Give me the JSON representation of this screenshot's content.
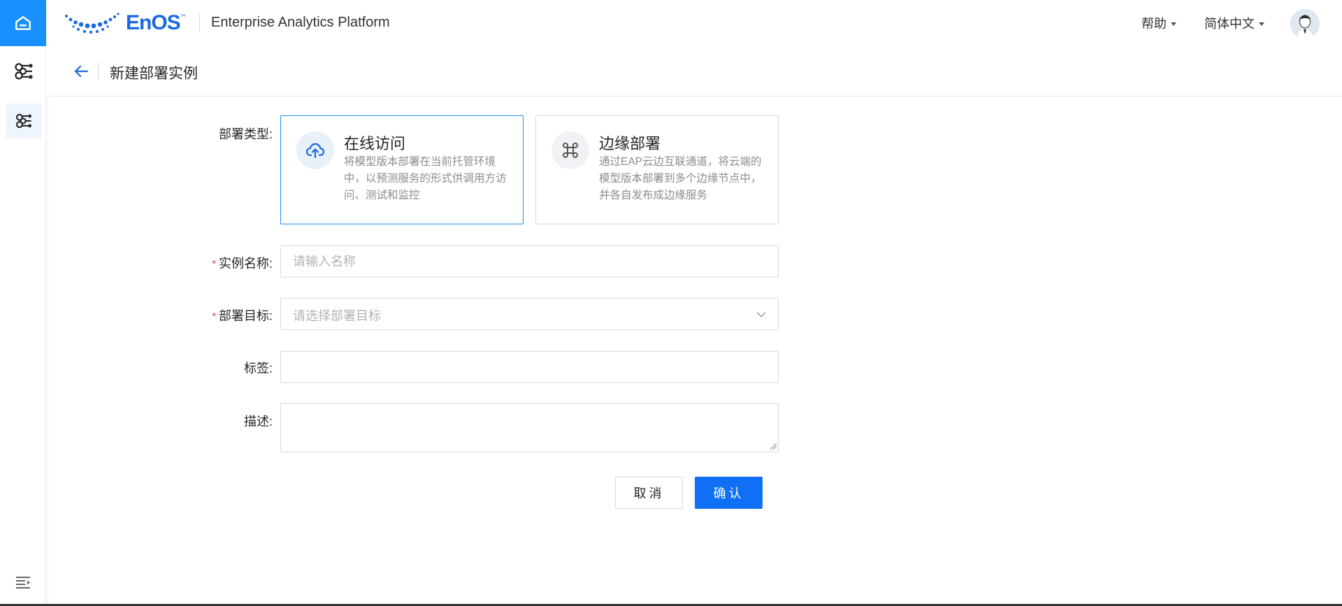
{
  "colors": {
    "primary": "#1890ff",
    "button_primary": "#0f6ff5",
    "required": "#f5222d",
    "border": "#d9d9d9"
  },
  "sidebar": {
    "home_icon": "home-icon",
    "items": [
      {
        "icon": "model-network-icon"
      },
      {
        "icon": "model-network-icon",
        "active": true
      }
    ],
    "collapse_icon": "menu-collapse-icon"
  },
  "header": {
    "logo_text": "EnOS",
    "logo_tm": "™",
    "app_title": "Enterprise Analytics Platform",
    "help_label": "帮助",
    "language_label": "简体中文"
  },
  "subheader": {
    "title": "新建部署实例"
  },
  "form": {
    "deploy_type": {
      "label": "部署类型:",
      "options": [
        {
          "title": "在线访问",
          "desc": "将模型版本部署在当前托管环境中，以预测服务的形式供调用方访问、测试和监控",
          "icon": "cloud-upload-icon",
          "selected": true
        },
        {
          "title": "边缘部署",
          "desc": "通过EAP云边互联通道，将云端的模型版本部署到多个边缘节点中，并各自发布成边缘服务",
          "icon": "command-icon",
          "selected": false
        }
      ]
    },
    "instance_name": {
      "label": "实例名称:",
      "placeholder": "请输入名称",
      "required": true,
      "value": ""
    },
    "deploy_target": {
      "label": "部署目标:",
      "placeholder": "请选择部署目标",
      "required": true
    },
    "tags": {
      "label": "标签:",
      "value": ""
    },
    "description": {
      "label": "描述:",
      "value": ""
    },
    "required_mark": "*",
    "cancel_label": "取消",
    "confirm_label": "确认"
  }
}
